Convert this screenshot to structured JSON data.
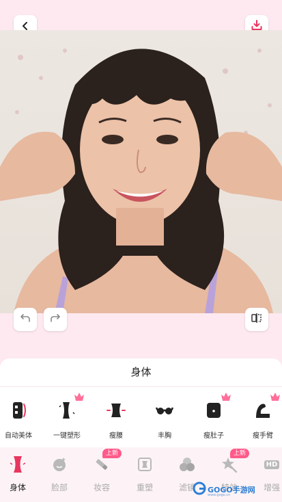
{
  "top_bar": {
    "back_icon": "chevron-left-icon",
    "download_icon": "download-icon"
  },
  "photo_controls": {
    "undo_icon": "undo-icon",
    "redo_icon": "redo-icon",
    "compare_icon": "compare-icon"
  },
  "panel": {
    "title": "身体",
    "tools": [
      {
        "label": "自动美体",
        "icon": "auto-body-icon",
        "crown": false
      },
      {
        "label": "一键塑形",
        "icon": "one-click-shape-icon",
        "crown": true
      },
      {
        "label": "瘦腰",
        "icon": "slim-waist-icon",
        "crown": false
      },
      {
        "label": "丰胸",
        "icon": "bust-icon",
        "crown": false
      },
      {
        "label": "瘦肚子",
        "icon": "slim-belly-icon",
        "crown": true
      },
      {
        "label": "瘦手臂",
        "icon": "slim-arm-icon",
        "crown": true
      }
    ]
  },
  "nav": {
    "items": [
      {
        "label": "身体",
        "icon": "body-icon",
        "active": true,
        "badge": ""
      },
      {
        "label": "脸部",
        "icon": "face-icon",
        "active": false,
        "badge": ""
      },
      {
        "label": "妆容",
        "icon": "makeup-icon",
        "active": false,
        "badge": "上新"
      },
      {
        "label": "重塑",
        "icon": "reshape-icon",
        "active": false,
        "badge": ""
      },
      {
        "label": "滤镜",
        "icon": "filter-icon",
        "active": false,
        "badge": ""
      },
      {
        "label": "特效",
        "icon": "effects-icon",
        "active": false,
        "badge": "上新"
      },
      {
        "label": "增强",
        "icon": "enhance-icon",
        "active": false,
        "badge": ""
      }
    ],
    "enhance_icon_text": "HD"
  },
  "watermark": {
    "text": "GOGO手游网",
    "sub": "www.gogo.cn"
  },
  "colors": {
    "accent": "#ff5a8a",
    "background": "#fde9ef",
    "active_icon": "#e8365f"
  }
}
